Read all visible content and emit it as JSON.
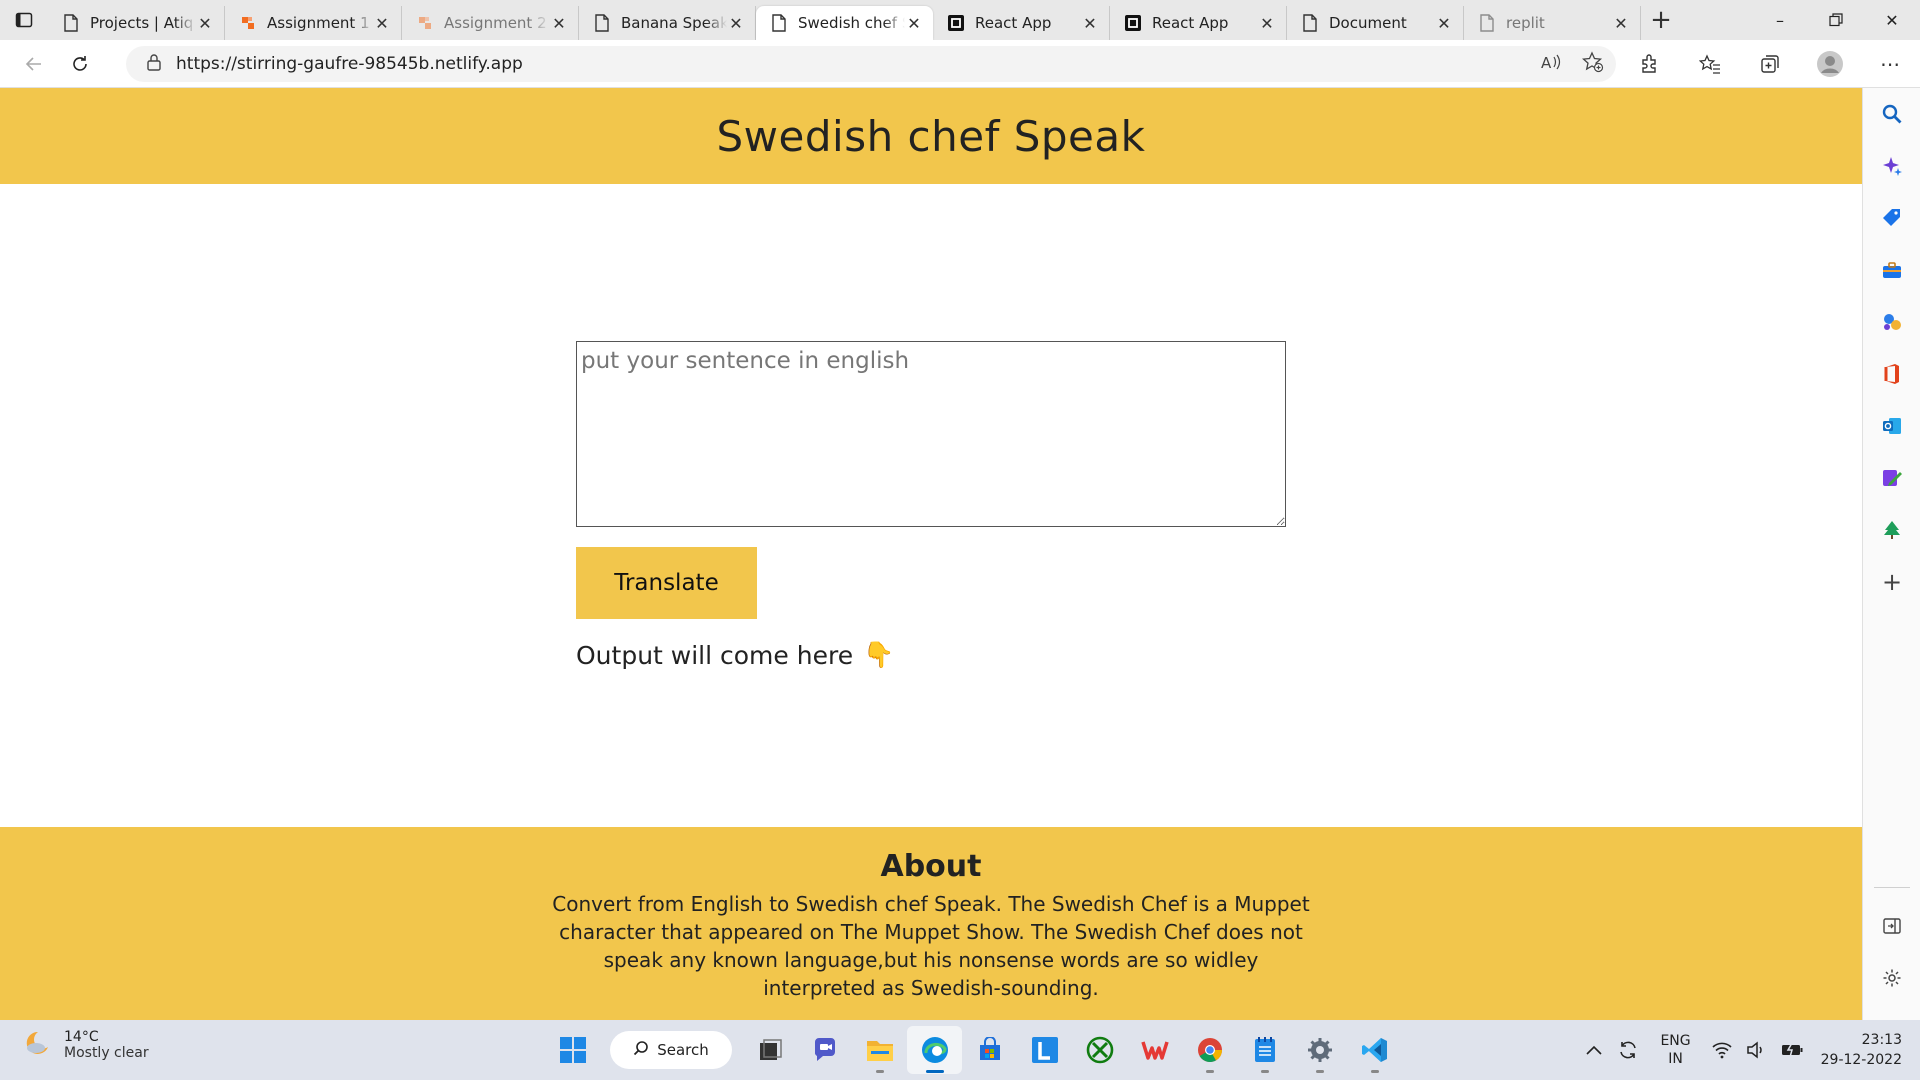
{
  "browser": {
    "tabs": [
      {
        "label": "Projects | Atiq",
        "icon": "page-icon",
        "active": false,
        "faded": false
      },
      {
        "label": "Assignment 1",
        "icon": "hashnode-icon",
        "active": false,
        "faded": false
      },
      {
        "label": "Assignment 2",
        "icon": "hashnode-icon",
        "active": false,
        "faded": true
      },
      {
        "label": "Banana Speak",
        "icon": "page-icon",
        "active": false,
        "faded": false
      },
      {
        "label": "Swedish chef Speak",
        "icon": "page-icon",
        "active": true,
        "faded": false
      },
      {
        "label": "React App",
        "icon": "react-app-icon",
        "active": false,
        "faded": false
      },
      {
        "label": "React App",
        "icon": "react-app-icon",
        "active": false,
        "faded": false
      },
      {
        "label": "Document",
        "icon": "page-icon",
        "active": false,
        "faded": false
      },
      {
        "label": "replit",
        "icon": "page-icon",
        "active": false,
        "faded": true
      }
    ],
    "address": {
      "url": "https://stirring-gaufre-98545b.netlify.app"
    }
  },
  "page": {
    "header_title": "Swedish chef Speak",
    "input_placeholder": "put your sentence in english",
    "input_value": "",
    "translate_label": "Translate",
    "output_text": "Output will come here",
    "output_emoji": "👇",
    "footer": {
      "title": "About",
      "text": "Convert from English to Swedish chef Speak. The Swedish Chef is a Muppet character that appeared on The Muppet Show. The Swedish Chef does not speak any known language,but his nonsense words are so widley interpreted as Swedish-sounding."
    }
  },
  "taskbar": {
    "weather": {
      "temp": "14°C",
      "desc": "Mostly clear"
    },
    "search_label": "Search",
    "lang": {
      "line1": "ENG",
      "line2": "IN"
    },
    "clock": {
      "time": "23:13",
      "date": "29-12-2022"
    }
  },
  "colors": {
    "brand_yellow": "#f2c64c",
    "edge_blue": "#0067c0"
  }
}
